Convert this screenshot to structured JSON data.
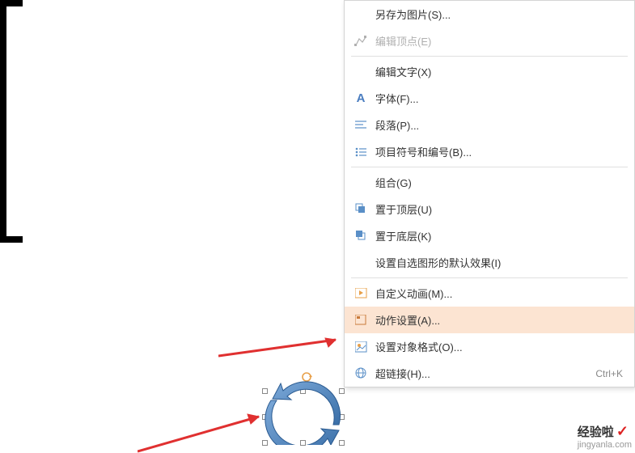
{
  "menu": {
    "items": [
      {
        "icon": "",
        "label": "另存为图片(S)...",
        "disabled": false
      },
      {
        "icon": "edit-points",
        "label": "编辑顶点(E)",
        "disabled": true
      },
      {
        "separator": true
      },
      {
        "icon": "",
        "label": "编辑文字(X)",
        "disabled": false
      },
      {
        "icon": "font-a",
        "label": "字体(F)...",
        "disabled": false
      },
      {
        "icon": "paragraph",
        "label": "段落(P)...",
        "disabled": false
      },
      {
        "icon": "bullets",
        "label": "项目符号和编号(B)...",
        "disabled": false
      },
      {
        "separator": true
      },
      {
        "icon": "",
        "label": "组合(G)",
        "disabled": false
      },
      {
        "icon": "bring-front",
        "label": "置于顶层(U)",
        "disabled": false
      },
      {
        "icon": "send-back",
        "label": "置于底层(K)",
        "disabled": false
      },
      {
        "icon": "",
        "label": "设置自选图形的默认效果(I)",
        "disabled": false
      },
      {
        "separator": true
      },
      {
        "icon": "animation",
        "label": "自定义动画(M)...",
        "disabled": false
      },
      {
        "icon": "action",
        "label": "动作设置(A)...",
        "disabled": false,
        "highlighted": true
      },
      {
        "icon": "format-obj",
        "label": "设置对象格式(O)...",
        "disabled": false
      },
      {
        "icon": "hyperlink",
        "label": "超链接(H)...",
        "disabled": false,
        "shortcut": "Ctrl+K"
      }
    ]
  },
  "watermark": {
    "brand": "经验啦",
    "check": "✓",
    "site": "jingyanla.com"
  }
}
